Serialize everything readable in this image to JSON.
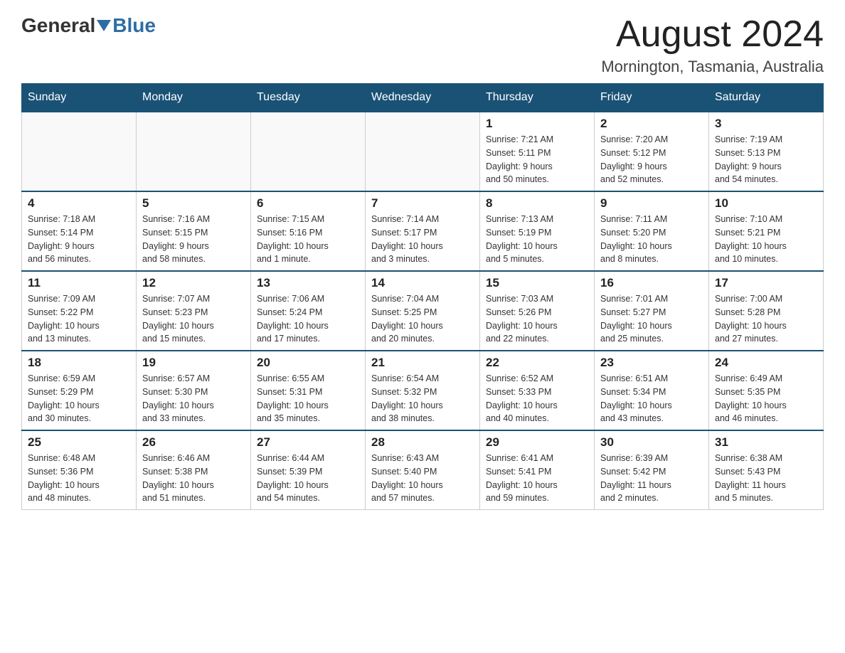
{
  "header": {
    "logo_general": "General",
    "logo_blue": "Blue",
    "month": "August 2024",
    "location": "Mornington, Tasmania, Australia"
  },
  "days_of_week": [
    "Sunday",
    "Monday",
    "Tuesday",
    "Wednesday",
    "Thursday",
    "Friday",
    "Saturday"
  ],
  "weeks": [
    [
      {
        "day": "",
        "info": ""
      },
      {
        "day": "",
        "info": ""
      },
      {
        "day": "",
        "info": ""
      },
      {
        "day": "",
        "info": ""
      },
      {
        "day": "1",
        "info": "Sunrise: 7:21 AM\nSunset: 5:11 PM\nDaylight: 9 hours\nand 50 minutes."
      },
      {
        "day": "2",
        "info": "Sunrise: 7:20 AM\nSunset: 5:12 PM\nDaylight: 9 hours\nand 52 minutes."
      },
      {
        "day": "3",
        "info": "Sunrise: 7:19 AM\nSunset: 5:13 PM\nDaylight: 9 hours\nand 54 minutes."
      }
    ],
    [
      {
        "day": "4",
        "info": "Sunrise: 7:18 AM\nSunset: 5:14 PM\nDaylight: 9 hours\nand 56 minutes."
      },
      {
        "day": "5",
        "info": "Sunrise: 7:16 AM\nSunset: 5:15 PM\nDaylight: 9 hours\nand 58 minutes."
      },
      {
        "day": "6",
        "info": "Sunrise: 7:15 AM\nSunset: 5:16 PM\nDaylight: 10 hours\nand 1 minute."
      },
      {
        "day": "7",
        "info": "Sunrise: 7:14 AM\nSunset: 5:17 PM\nDaylight: 10 hours\nand 3 minutes."
      },
      {
        "day": "8",
        "info": "Sunrise: 7:13 AM\nSunset: 5:19 PM\nDaylight: 10 hours\nand 5 minutes."
      },
      {
        "day": "9",
        "info": "Sunrise: 7:11 AM\nSunset: 5:20 PM\nDaylight: 10 hours\nand 8 minutes."
      },
      {
        "day": "10",
        "info": "Sunrise: 7:10 AM\nSunset: 5:21 PM\nDaylight: 10 hours\nand 10 minutes."
      }
    ],
    [
      {
        "day": "11",
        "info": "Sunrise: 7:09 AM\nSunset: 5:22 PM\nDaylight: 10 hours\nand 13 minutes."
      },
      {
        "day": "12",
        "info": "Sunrise: 7:07 AM\nSunset: 5:23 PM\nDaylight: 10 hours\nand 15 minutes."
      },
      {
        "day": "13",
        "info": "Sunrise: 7:06 AM\nSunset: 5:24 PM\nDaylight: 10 hours\nand 17 minutes."
      },
      {
        "day": "14",
        "info": "Sunrise: 7:04 AM\nSunset: 5:25 PM\nDaylight: 10 hours\nand 20 minutes."
      },
      {
        "day": "15",
        "info": "Sunrise: 7:03 AM\nSunset: 5:26 PM\nDaylight: 10 hours\nand 22 minutes."
      },
      {
        "day": "16",
        "info": "Sunrise: 7:01 AM\nSunset: 5:27 PM\nDaylight: 10 hours\nand 25 minutes."
      },
      {
        "day": "17",
        "info": "Sunrise: 7:00 AM\nSunset: 5:28 PM\nDaylight: 10 hours\nand 27 minutes."
      }
    ],
    [
      {
        "day": "18",
        "info": "Sunrise: 6:59 AM\nSunset: 5:29 PM\nDaylight: 10 hours\nand 30 minutes."
      },
      {
        "day": "19",
        "info": "Sunrise: 6:57 AM\nSunset: 5:30 PM\nDaylight: 10 hours\nand 33 minutes."
      },
      {
        "day": "20",
        "info": "Sunrise: 6:55 AM\nSunset: 5:31 PM\nDaylight: 10 hours\nand 35 minutes."
      },
      {
        "day": "21",
        "info": "Sunrise: 6:54 AM\nSunset: 5:32 PM\nDaylight: 10 hours\nand 38 minutes."
      },
      {
        "day": "22",
        "info": "Sunrise: 6:52 AM\nSunset: 5:33 PM\nDaylight: 10 hours\nand 40 minutes."
      },
      {
        "day": "23",
        "info": "Sunrise: 6:51 AM\nSunset: 5:34 PM\nDaylight: 10 hours\nand 43 minutes."
      },
      {
        "day": "24",
        "info": "Sunrise: 6:49 AM\nSunset: 5:35 PM\nDaylight: 10 hours\nand 46 minutes."
      }
    ],
    [
      {
        "day": "25",
        "info": "Sunrise: 6:48 AM\nSunset: 5:36 PM\nDaylight: 10 hours\nand 48 minutes."
      },
      {
        "day": "26",
        "info": "Sunrise: 6:46 AM\nSunset: 5:38 PM\nDaylight: 10 hours\nand 51 minutes."
      },
      {
        "day": "27",
        "info": "Sunrise: 6:44 AM\nSunset: 5:39 PM\nDaylight: 10 hours\nand 54 minutes."
      },
      {
        "day": "28",
        "info": "Sunrise: 6:43 AM\nSunset: 5:40 PM\nDaylight: 10 hours\nand 57 minutes."
      },
      {
        "day": "29",
        "info": "Sunrise: 6:41 AM\nSunset: 5:41 PM\nDaylight: 10 hours\nand 59 minutes."
      },
      {
        "day": "30",
        "info": "Sunrise: 6:39 AM\nSunset: 5:42 PM\nDaylight: 11 hours\nand 2 minutes."
      },
      {
        "day": "31",
        "info": "Sunrise: 6:38 AM\nSunset: 5:43 PM\nDaylight: 11 hours\nand 5 minutes."
      }
    ]
  ]
}
